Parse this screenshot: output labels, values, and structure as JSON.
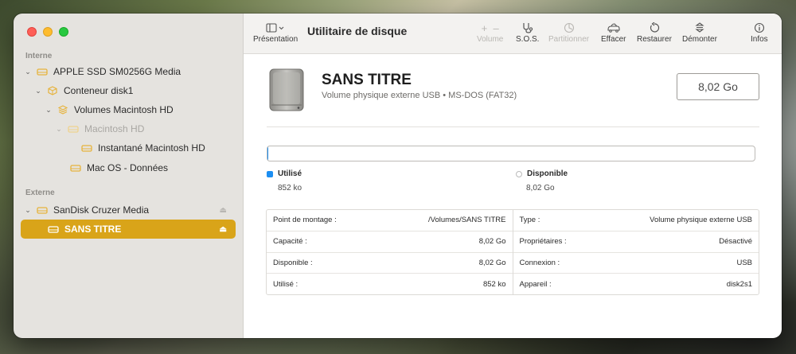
{
  "colors": {
    "accent": "#d9a419",
    "used": "#1c8ef2",
    "folder": "#e6b33c"
  },
  "sidebar": {
    "section_internal": "Interne",
    "section_external": "Externe",
    "items": [
      {
        "label": "APPLE SSD SM0256G Media",
        "icon": "drive-icon"
      },
      {
        "label": "Conteneur disk1",
        "icon": "container-icon"
      },
      {
        "label": "Volumes Macintosh HD",
        "icon": "stack-icon"
      },
      {
        "label": "Macintosh HD",
        "icon": "drive-icon"
      },
      {
        "label": "Instantané Macintosh HD",
        "icon": "drive-icon"
      },
      {
        "label": "Mac OS - Données",
        "icon": "drive-icon"
      },
      {
        "label": "SanDisk Cruzer Media",
        "icon": "drive-icon"
      },
      {
        "label": "SANS TITRE",
        "icon": "drive-icon",
        "selected": true
      }
    ]
  },
  "toolbar": {
    "view_label": "Présentation",
    "title": "Utilitaire de disque",
    "volume_label": "Volume",
    "sos_label": "S.O.S.",
    "partition_label": "Partitionner",
    "erase_label": "Effacer",
    "restore_label": "Restaurer",
    "unmount_label": "Démonter",
    "info_label": "Infos"
  },
  "volume": {
    "name": "SANS TITRE",
    "description": "Volume physique externe USB • MS-DOS (FAT32)",
    "size": "8,02 Go",
    "used_fraction": 0.0001
  },
  "usage": {
    "used_label": "Utilisé",
    "used_value": "852 ko",
    "free_label": "Disponible",
    "free_value": "8,02 Go"
  },
  "details": {
    "left": [
      {
        "key": "Point de montage :",
        "value": "/Volumes/SANS TITRE"
      },
      {
        "key": "Capacité :",
        "value": "8,02 Go"
      },
      {
        "key": "Disponible :",
        "value": "8,02 Go"
      },
      {
        "key": "Utilisé :",
        "value": "852 ko"
      }
    ],
    "right": [
      {
        "key": "Type :",
        "value": "Volume physique externe USB"
      },
      {
        "key": "Propriétaires :",
        "value": "Désactivé"
      },
      {
        "key": "Connexion :",
        "value": "USB"
      },
      {
        "key": "Appareil :",
        "value": "disk2s1"
      }
    ]
  }
}
